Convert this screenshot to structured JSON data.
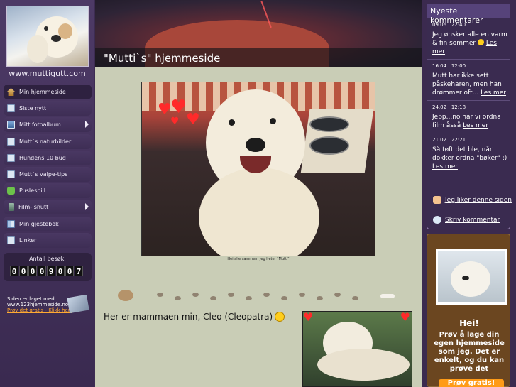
{
  "sidebar": {
    "site_url": "www.muttigutt.com",
    "nav": [
      {
        "label": "Min hjemmeside",
        "icon": "home-icon",
        "active": true,
        "submenu": false
      },
      {
        "label": "Siste nytt",
        "icon": "page-icon",
        "active": false,
        "submenu": false
      },
      {
        "label": "Mitt fotoalbum",
        "icon": "photo-album-icon",
        "active": false,
        "submenu": true
      },
      {
        "label": "Mutt`s naturbilder",
        "icon": "page-icon",
        "active": false,
        "submenu": false
      },
      {
        "label": "Hundens 10 bud",
        "icon": "page-icon",
        "active": false,
        "submenu": false
      },
      {
        "label": "Mutt`s valpe-tips",
        "icon": "page-icon",
        "active": false,
        "submenu": false
      },
      {
        "label": "Puslespill",
        "icon": "puzzle-icon",
        "active": false,
        "submenu": false
      },
      {
        "label": "Film- snutt",
        "icon": "film-icon",
        "active": false,
        "submenu": true
      },
      {
        "label": "Min gjestebok",
        "icon": "guestbook-icon",
        "active": false,
        "submenu": false
      },
      {
        "label": "Linker",
        "icon": "page-icon",
        "active": false,
        "submenu": false
      }
    ],
    "counter": {
      "label": "Antall besøk:",
      "value": "00009007"
    },
    "made_with": {
      "line1": "Siden er laget med",
      "line2": "www.123hjemmeside.no",
      "link": "Prøv det gratis - Klikk her!"
    }
  },
  "header": {
    "title": "\"Mutti`s\" hjemmeside"
  },
  "main": {
    "photo_caption": "Hei alle sammen! Jeg heter \"Mutti\"",
    "intro_text": "Her er mammaen min, Cleo (Cleopatra)"
  },
  "comments": {
    "title": "Nyeste kommentarer",
    "items": [
      {
        "date": "09.06 | 22:40",
        "text": "Jeg ønsker alle en varm & fin sommer",
        "link": "Les mer",
        "smiley": true
      },
      {
        "date": "16.04 | 12:00",
        "text": "Mutt har ikke sett påskeharen, men han drømmer oft...",
        "link": "Les mer",
        "smiley": false
      },
      {
        "date": "24.02 | 12:18",
        "text": "Jepp...no har vi ordna film åsså",
        "link": "Les mer",
        "smiley": false
      },
      {
        "date": "21.02 | 22:21",
        "text": "Så tøft det ble, når dokker ordna \"bøker\" :)",
        "link": "Les mer",
        "smiley": false
      }
    ],
    "like_label": "Jeg liker denne siden",
    "write_label": "Skriv kommentar"
  },
  "promo": {
    "greeting": "Hei!",
    "text": "Prøv å lage din egen hjemmeside som jeg. Det er enkelt, og du kan prøve det",
    "button_label": "Prøv gratis!"
  },
  "colors": {
    "sidebar_bg": "#4d3a66",
    "center_bg": "#c9cdb6",
    "promo_bg": "#6b4620",
    "promo_button": "#ff9b17"
  }
}
